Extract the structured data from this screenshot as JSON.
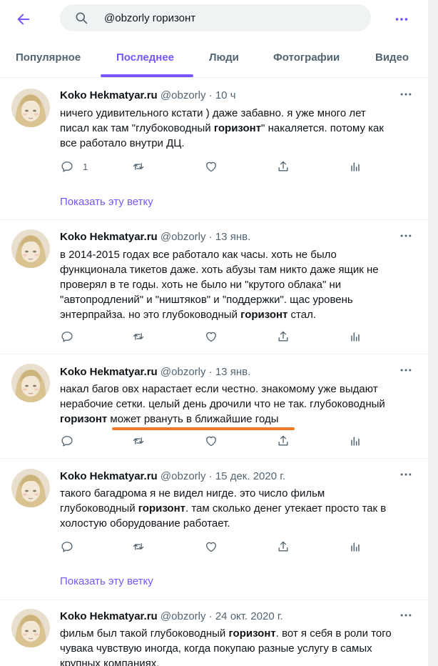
{
  "search": {
    "query": "@obzorly горизонт"
  },
  "tabs": [
    {
      "label": "Популярное"
    },
    {
      "label": "Последнее"
    },
    {
      "label": "Люди"
    },
    {
      "label": "Фотографии"
    },
    {
      "label": "Видео"
    }
  ],
  "colors": {
    "accent": "#7856ff",
    "highlight_underline": "#f2772b",
    "text": "#0f1419",
    "muted": "#536471"
  },
  "icons": {
    "back": "arrow-left-icon",
    "search": "search-icon",
    "more": "more-vertical-icon",
    "reply": "reply-icon",
    "retweet": "retweet-icon",
    "like": "like-icon",
    "share": "share-icon",
    "analytics": "analytics-icon"
  },
  "tweets": [
    {
      "name": "Koko Hekmatyar.ru",
      "handle": "@obzorly",
      "dot": "·",
      "time": "10 ч",
      "text_parts": [
        "ничего удивительного кстати ) даже забавно. я уже много лет писал как там \"глубоководный ",
        "горизонт",
        "\" накаляется. потому как все работало внутри ДЦ."
      ],
      "reply_count": "1",
      "thread_link": "Показать эту ветку"
    },
    {
      "name": "Koko Hekmatyar.ru",
      "handle": "@obzorly",
      "dot": "·",
      "time": "13 янв.",
      "text_parts": [
        "в 2014-2015 годах все работало как часы. хоть не было функционала тикетов даже. хоть абузы там никто даже ящик не проверял в те годы. хоть не было ни \"крутого облака\" ни \"автопродлений\" и \"ништяков\" и \"поддержки\". щас уровень энтерпрайза. но это глубоководный ",
        "горизонт",
        " стал."
      ]
    },
    {
      "name": "Koko Hekmatyar.ru",
      "handle": "@obzorly",
      "dot": "·",
      "time": "13 янв.",
      "text_parts": [
        "накал багов овх нарастает если честно. знакомому уже выдают нерабочие сетки. целый день дрочили что не так. глубоководный ",
        "горизонт",
        " может рвануть в ближайшие годы"
      ]
    },
    {
      "name": "Koko Hekmatyar.ru",
      "handle": "@obzorly",
      "dot": "·",
      "time": "15 дек. 2020 г.",
      "text_parts": [
        "такого багадрома я не видел нигде. это число фильм глубоководный ",
        "горизонт",
        ". там сколько денег утекает просто так в холостую оборудование работает."
      ],
      "thread_link": "Показать эту ветку"
    },
    {
      "name": "Koko Hekmatyar.ru",
      "handle": "@obzorly",
      "dot": "·",
      "time": "24 окт. 2020 г.",
      "text_parts": [
        "фильм был такой глубоководный ",
        "горизонт",
        ". вот я себя в роли того чувака чувствую иногда, когда покупаю разные услугу в самых крупных компаниях."
      ]
    }
  ]
}
